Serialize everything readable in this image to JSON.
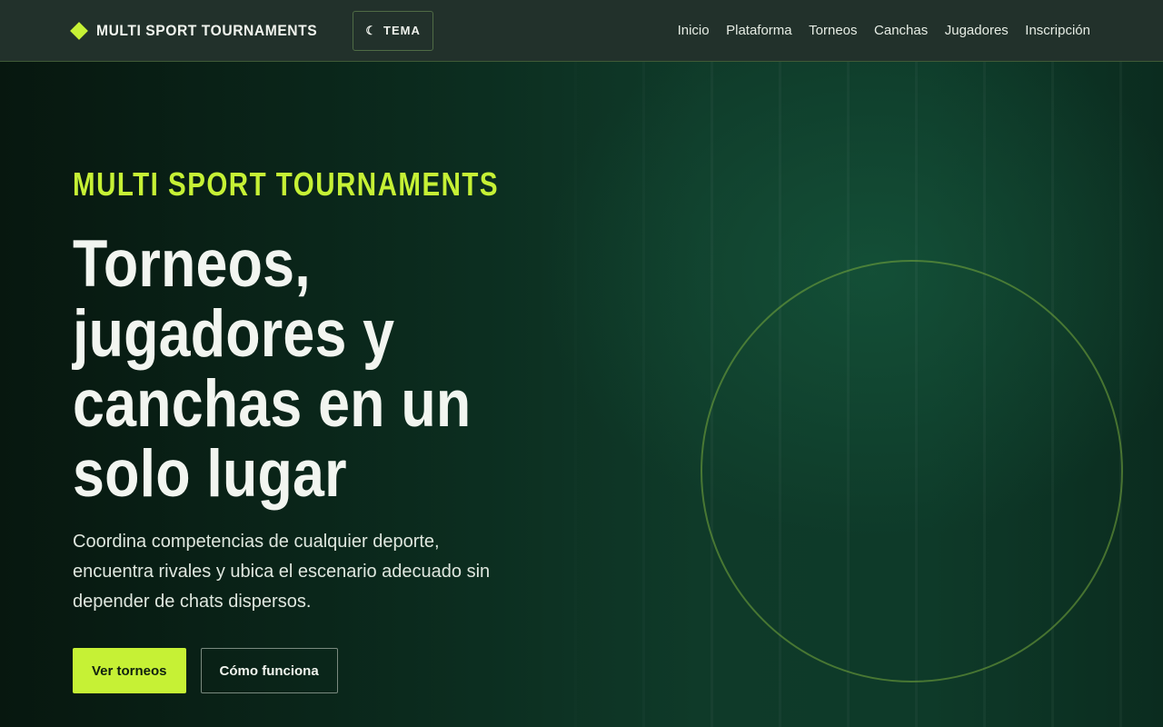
{
  "header": {
    "brand_name": "MULTI SPORT TOURNAMENTS",
    "brand_icon": "diamond-icon",
    "theme_icon": "moon-icon",
    "theme_label": "TEMA",
    "nav": [
      {
        "label": "Inicio"
      },
      {
        "label": "Plataforma"
      },
      {
        "label": "Torneos"
      },
      {
        "label": "Canchas"
      },
      {
        "label": "Jugadores"
      },
      {
        "label": "Inscripción"
      }
    ]
  },
  "hero": {
    "eyebrow": "MULTI SPORT TOURNAMENTS",
    "headline": "Torneos, jugadores y canchas en un solo lugar",
    "lead": "Coordina competencias de cualquier deporte, encuentra rivales y ubica el escenario adecuado sin depender de chats dispersos.",
    "primary_cta": "Ver torneos",
    "secondary_cta": "Cómo funciona"
  },
  "colors": {
    "accent": "#c6f135",
    "background": "#0b2a1d",
    "header_bg": "#22312b"
  }
}
